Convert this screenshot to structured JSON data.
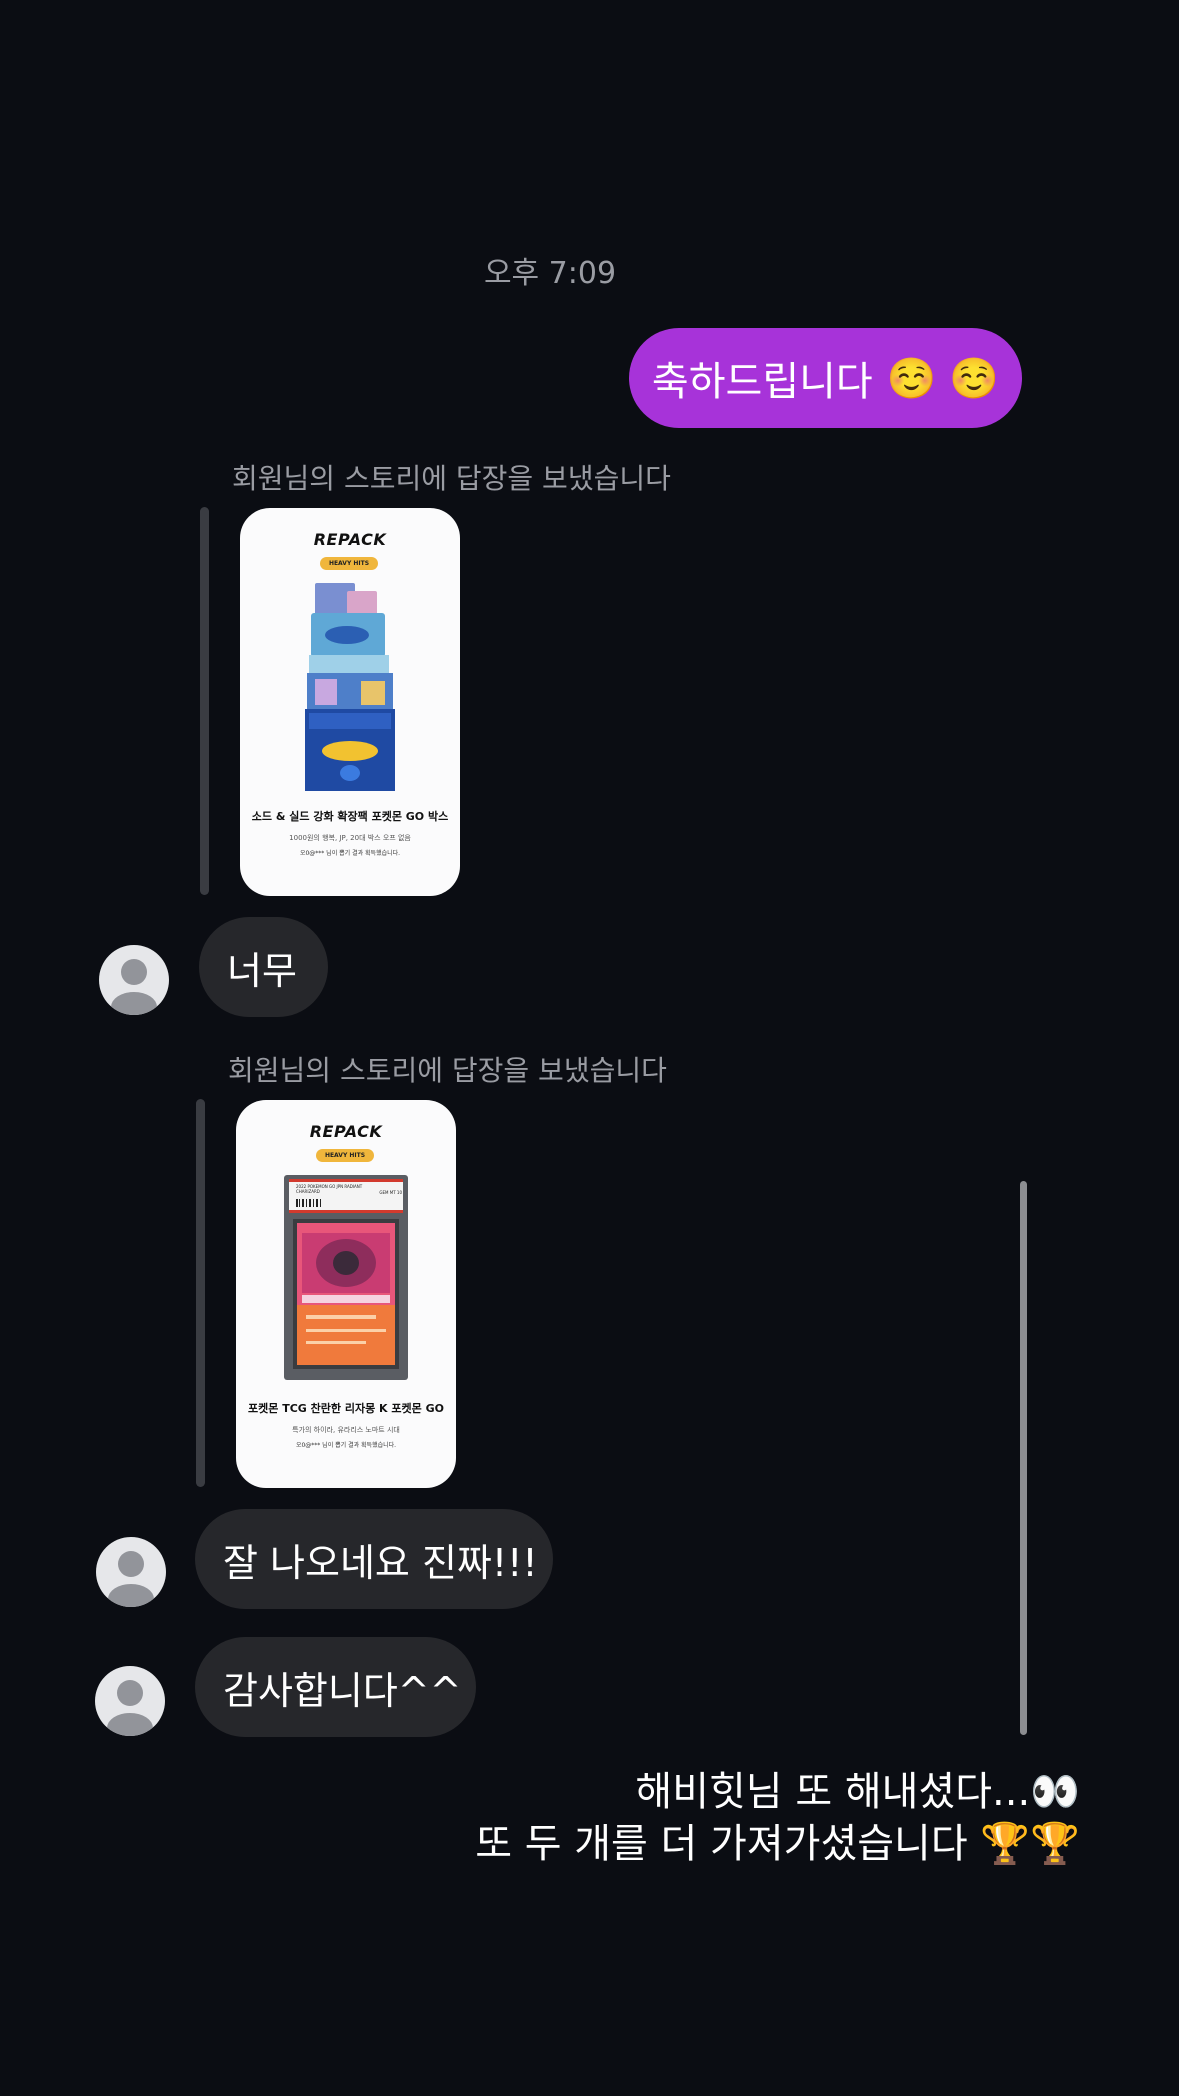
{
  "timestamp": "오후 7:09",
  "sent_message": {
    "text": "축하드립니다",
    "emoji": "☺️ ☺️"
  },
  "threads": [
    {
      "reply_label": "회원님의 스토리에 답장을 보냈습니다",
      "story": {
        "logo": "REPACK",
        "pill": "HEAVY HITS",
        "title": "소드 & 실드 강화 확장팩 포켓몬 GO 박스",
        "subtitle": "1000원의 행복, JP, 20대 박스 오프 없음",
        "footer": "오0@*** 님이 뽑기 결과 획득했습니다."
      },
      "message": "너무"
    },
    {
      "reply_label": "회원님의 스토리에 답장을 보냈습니다",
      "story": {
        "logo": "REPACK",
        "pill": "HEAVY HITS",
        "title": "포켓몬 TCG 찬란한 리자몽 K 포켓몬 GO",
        "subtitle": "특가의 하이라, 유라리스 노마트 시대",
        "footer": "오0@*** 님이 뽑기 결과 획득했습니다.",
        "slab_label": "2022 POKEMON GO JPN RADIANT CHARIZARD",
        "slab_grade": "GEM MT 10"
      },
      "message": "잘 나오네요 진짜!!!"
    }
  ],
  "extra_message": "감사합니다^^",
  "story_overlay": {
    "line1": "해비힛님 또 해내셨다...",
    "line1_emoji": "👀",
    "line2": "또 두 개를 더 가져가셨습니다",
    "line2_emoji": "🏆🏆"
  },
  "colors": {
    "background": "#0b0d13",
    "sent_bubble": "#a733d9",
    "received_bubble": "#26272b"
  }
}
